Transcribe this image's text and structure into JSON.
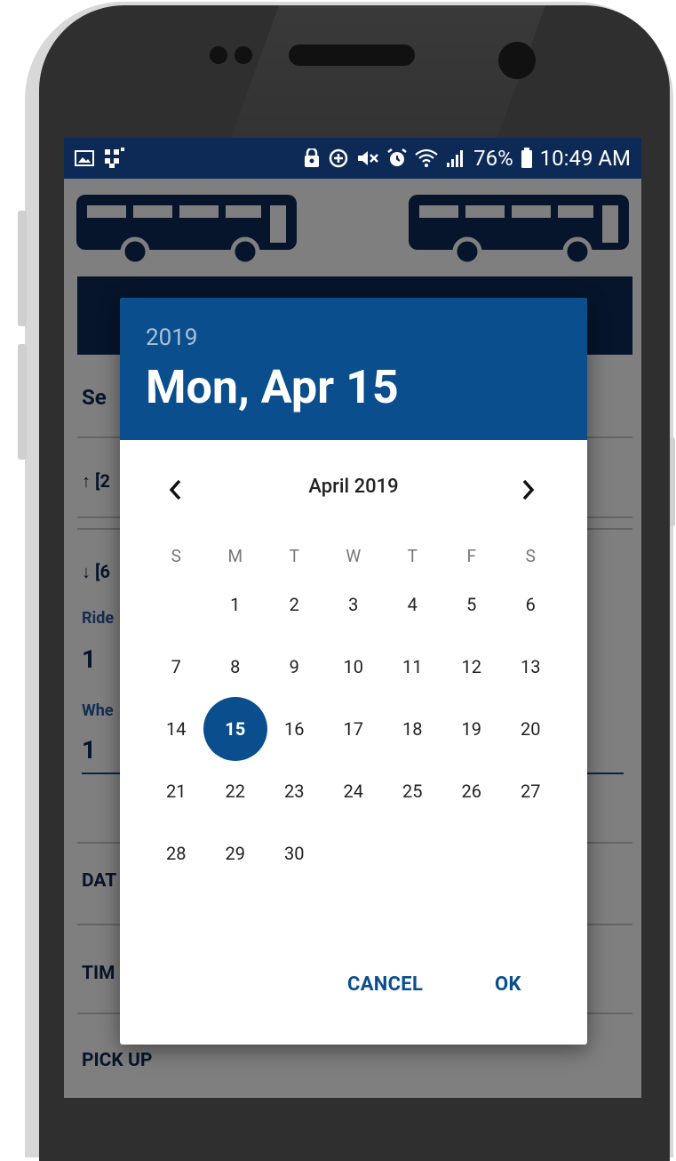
{
  "status_bar": {
    "battery_percent": "76%",
    "time": "10:49 AM",
    "left_icons": [
      "image-icon",
      "cast-icon"
    ],
    "right_icons": [
      "lock-icon",
      "data-saver-icon",
      "mute-icon",
      "alarm-icon",
      "wifi-icon",
      "signal-icon",
      "battery-icon"
    ]
  },
  "background": {
    "section_partial": "Se",
    "route_up_partial": "↑ [2",
    "route_down_partial": "↓ [6",
    "riders_label_partial": "Ride",
    "riders_value": "1",
    "wheelchair_label_partial": "Whe",
    "wheelchair_value": "1",
    "date_label_partial": "DAT",
    "time_label_partial": "TIM",
    "pickup_label": "PICK UP"
  },
  "dialog": {
    "year": "2019",
    "selected_date": "Mon, Apr 15",
    "month_title": "April 2019",
    "weekdays": [
      "S",
      "M",
      "T",
      "W",
      "T",
      "F",
      "S"
    ],
    "weeks": [
      [
        "",
        "1",
        "2",
        "3",
        "4",
        "5",
        "6"
      ],
      [
        "7",
        "8",
        "9",
        "10",
        "11",
        "12",
        "13"
      ],
      [
        "14",
        "15",
        "16",
        "17",
        "18",
        "19",
        "20"
      ],
      [
        "21",
        "22",
        "23",
        "24",
        "25",
        "26",
        "27"
      ],
      [
        "28",
        "29",
        "30",
        "",
        "",
        "",
        ""
      ]
    ],
    "selected_day": "15",
    "cancel_label": "CANCEL",
    "ok_label": "OK"
  },
  "colors": {
    "primary": "#0a4e8e",
    "navy": "#0d2a57"
  }
}
